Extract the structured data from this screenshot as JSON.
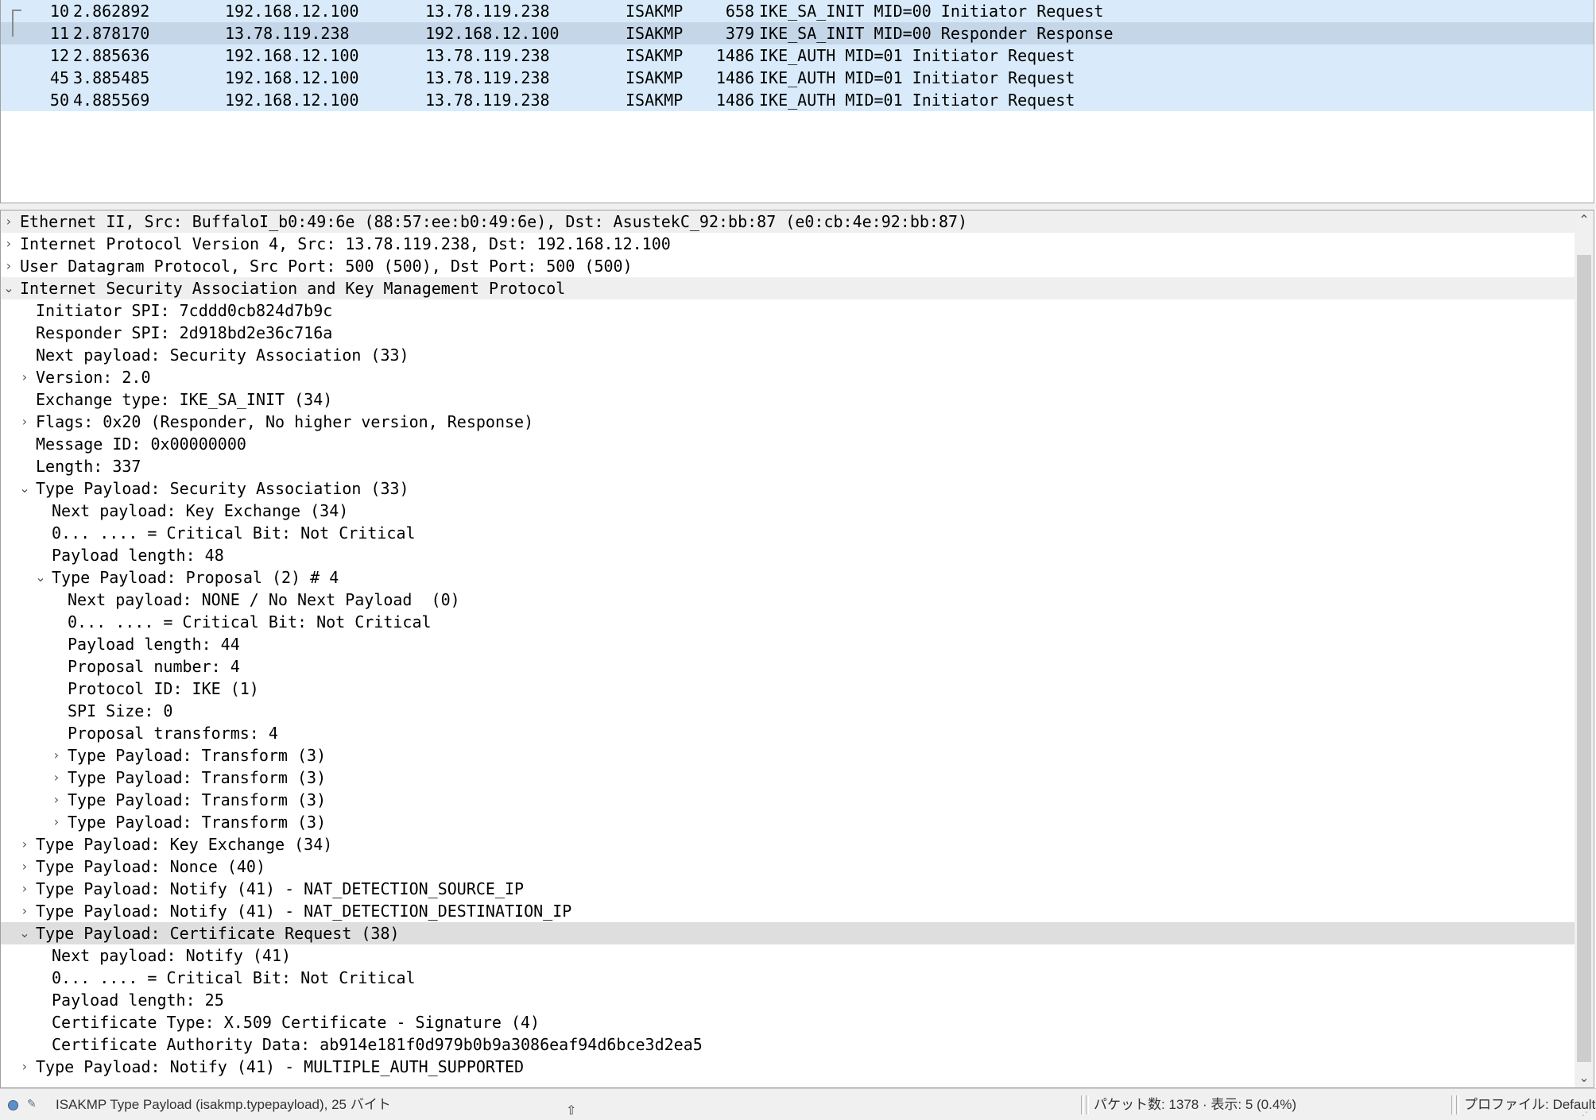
{
  "packets": [
    {
      "no": "10",
      "time": "2.862892",
      "src": "192.168.12.100",
      "dst": "13.78.119.238",
      "proto": "ISAKMP",
      "len": "658",
      "info": "IKE_SA_INIT MID=00 Initiator Request"
    },
    {
      "no": "11",
      "time": "2.878170",
      "src": "13.78.119.238",
      "dst": "192.168.12.100",
      "proto": "ISAKMP",
      "len": "379",
      "info": "IKE_SA_INIT MID=00 Responder Response"
    },
    {
      "no": "12",
      "time": "2.885636",
      "src": "192.168.12.100",
      "dst": "13.78.119.238",
      "proto": "ISAKMP",
      "len": "1486",
      "info": "IKE_AUTH MID=01 Initiator Request"
    },
    {
      "no": "45",
      "time": "3.885485",
      "src": "192.168.12.100",
      "dst": "13.78.119.238",
      "proto": "ISAKMP",
      "len": "1486",
      "info": "IKE_AUTH MID=01 Initiator Request"
    },
    {
      "no": "50",
      "time": "4.885569",
      "src": "192.168.12.100",
      "dst": "13.78.119.238",
      "proto": "ISAKMP",
      "len": "1486",
      "info": "IKE_AUTH MID=01 Initiator Request"
    }
  ],
  "tree": [
    "Ethernet II, Src: BuffaloI_b0:49:6e (88:57:ee:b0:49:6e), Dst: AsustekC_92:bb:87 (e0:cb:4e:92:bb:87)",
    "Internet Protocol Version 4, Src: 13.78.119.238, Dst: 192.168.12.100",
    "User Datagram Protocol, Src Port: 500 (500), Dst Port: 500 (500)",
    "Internet Security Association and Key Management Protocol",
    "Initiator SPI: 7cddd0cb824d7b9c",
    "Responder SPI: 2d918bd2e36c716a",
    "Next payload: Security Association (33)",
    "Version: 2.0",
    "Exchange type: IKE_SA_INIT (34)",
    "Flags: 0x20 (Responder, No higher version, Response)",
    "Message ID: 0x00000000",
    "Length: 337",
    "Type Payload: Security Association (33)",
    "Next payload: Key Exchange (34)",
    "0... .... = Critical Bit: Not Critical",
    "Payload length: 48",
    "Type Payload: Proposal (2) # 4",
    "Next payload: NONE / No Next Payload  (0)",
    "0... .... = Critical Bit: Not Critical",
    "Payload length: 44",
    "Proposal number: 4",
    "Protocol ID: IKE (1)",
    "SPI Size: 0",
    "Proposal transforms: 4",
    "Type Payload: Transform (3)",
    "Type Payload: Transform (3)",
    "Type Payload: Transform (3)",
    "Type Payload: Transform (3)",
    "Type Payload: Key Exchange (34)",
    "Type Payload: Nonce (40)",
    "Type Payload: Notify (41) - NAT_DETECTION_SOURCE_IP",
    "Type Payload: Notify (41) - NAT_DETECTION_DESTINATION_IP",
    "Type Payload: Certificate Request (38)",
    "Next payload: Notify (41)",
    "0... .... = Critical Bit: Not Critical",
    "Payload length: 25",
    "Certificate Type: X.509 Certificate - Signature (4)",
    "Certificate Authority Data: ab914e181f0d979b0b9a3086eaf94d6bce3d2ea5",
    "Type Payload: Notify (41) - MULTIPLE_AUTH_SUPPORTED"
  ],
  "status": {
    "field_info": "ISAKMP Type Payload (isakmp.typepayload), 25 バイト",
    "packet_stats": "パケット数: 1378 · 表示: 5 (0.4%)",
    "profile": "プロファイル: Default"
  },
  "colors": {
    "row_bg": "#d9ebfa",
    "row_selected": "#c4d6e8",
    "tree_selected": "#dedede",
    "tree_highlight": "#efefef"
  }
}
